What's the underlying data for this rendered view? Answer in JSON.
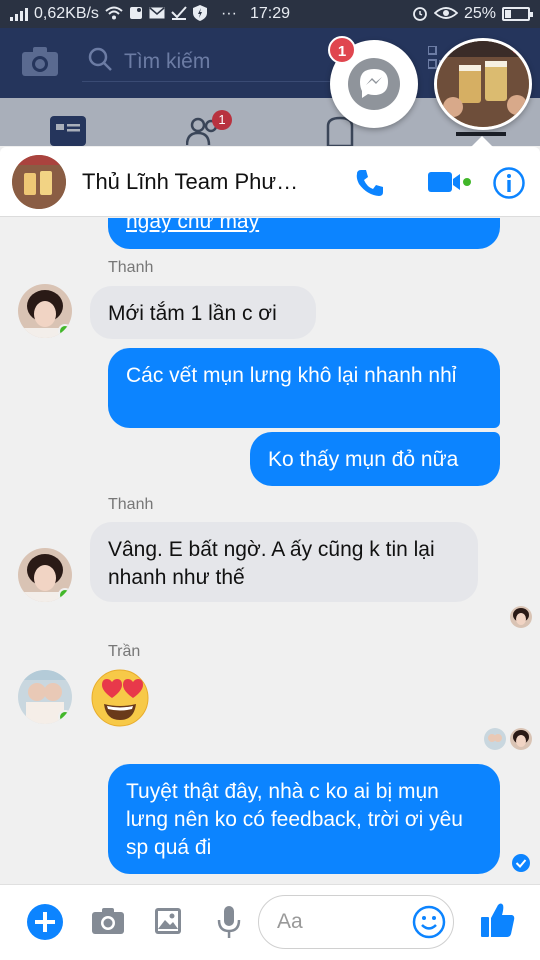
{
  "status_bar": {
    "speed": "0,62KB/s",
    "time": "17:29",
    "battery": "25%",
    "battery_level": 0.25,
    "dots": "···"
  },
  "fb_header": {
    "search_placeholder": "Tìm kiếm",
    "friends_badge": "1"
  },
  "messenger_head": {
    "badge": "1"
  },
  "chat": {
    "title": "Thủ Lĩnh Team Phư…"
  },
  "messages": [
    {
      "type": "out",
      "text": "ngay chứ mày"
    },
    {
      "type": "sender",
      "text": "Thanh"
    },
    {
      "type": "in",
      "text": "Mới tắm 1 lần c ơi"
    },
    {
      "type": "out",
      "text": "Các vết mụn lưng khô lại nhanh nhỉ"
    },
    {
      "type": "out",
      "text": "Ko thấy mụn đỏ nữa"
    },
    {
      "type": "sender",
      "text": "Thanh"
    },
    {
      "type": "in",
      "text": "Vâng. E bất ngờ. A ấy cũng k tin lại nhanh như thế"
    },
    {
      "type": "sender",
      "text": "Trần"
    },
    {
      "type": "out",
      "text": "Tuyệt thật đây, nhà c ko ai bị mụn lưng nên ko có feedback, trời ơi yêu sp quá đi"
    }
  ],
  "composer": {
    "placeholder": "Aa"
  },
  "colors": {
    "accent": "#0c84ff",
    "incoming": "#e5e6ea",
    "online": "#42b72a",
    "badge": "#e0464f"
  },
  "icons": [
    "camera-icon",
    "search-icon",
    "qr-icon",
    "messenger-icon",
    "phone-icon",
    "video-icon",
    "info-icon",
    "plus-icon",
    "photo-icon",
    "mic-icon",
    "emoji-icon",
    "like-icon"
  ]
}
